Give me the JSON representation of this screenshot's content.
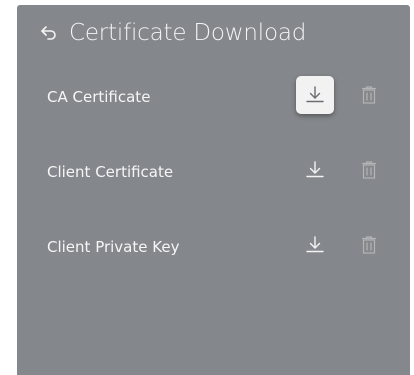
{
  "header": {
    "title": "Certificate Download",
    "back_icon": "back-arrow-icon"
  },
  "rows": [
    {
      "label": "CA Certificate",
      "download_icon": "download-icon",
      "delete_icon": "trash-icon",
      "download_focused": true,
      "delete_enabled": false
    },
    {
      "label": "Client Certificate",
      "download_icon": "download-icon",
      "delete_icon": "trash-icon",
      "download_focused": false,
      "delete_enabled": false
    },
    {
      "label": "Client Private Key",
      "download_icon": "download-icon",
      "delete_icon": "trash-icon",
      "download_focused": false,
      "delete_enabled": false
    }
  ],
  "colors": {
    "panel_bg": "#84878b",
    "text": "#f6f6f6",
    "focus_bg": "#f2f2f2",
    "focus_icon": "#6a6d72"
  }
}
